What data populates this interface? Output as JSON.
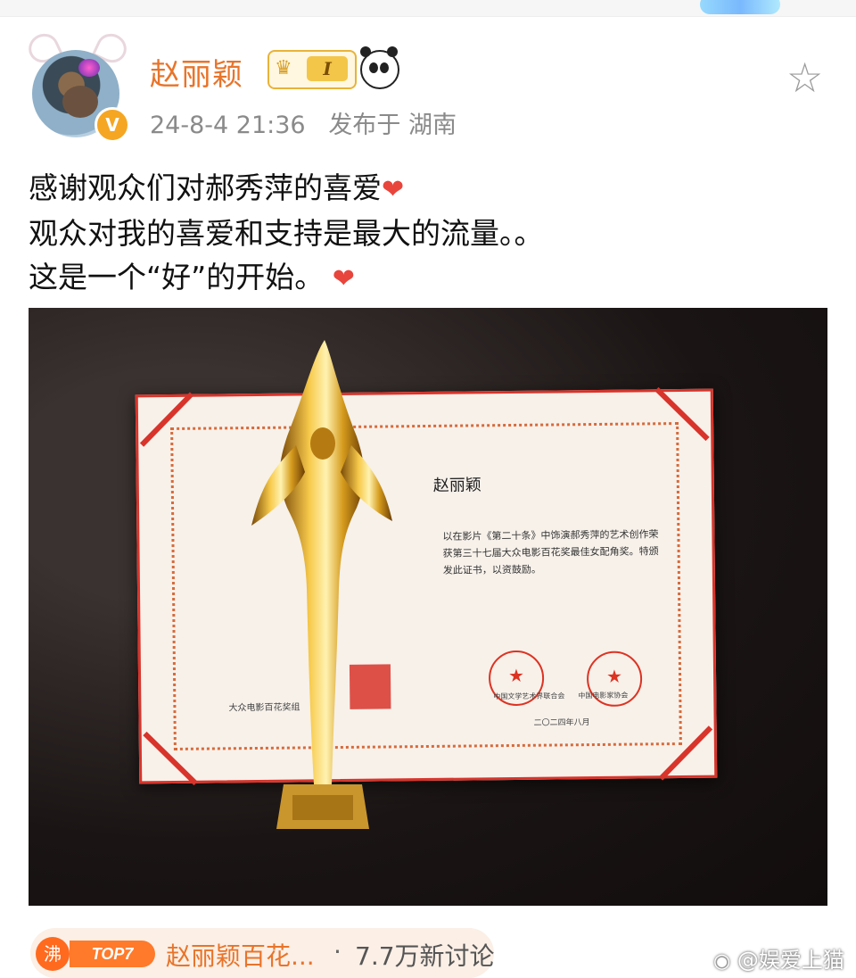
{
  "post": {
    "username": "赵丽颖",
    "level_badge": "I",
    "timestamp": "24-8-4 21:36",
    "location": "发布于 湖南",
    "text_lines": [
      "感谢观众们对郝秀萍的喜爱",
      "观众对我的喜爱和支持是最大的流量。。",
      "这是一个“好”的开始。"
    ],
    "icons": [
      "crown-badge-icon",
      "panda-icon",
      "star-icon",
      "heart-icon",
      "verified-icon"
    ],
    "accent_color": "#e8742a"
  },
  "certificate": {
    "recipient": "赵丽颖",
    "body": "以在影片《第二十条》中饰演郝秀萍的艺术创作荣获第三十七届大众电影百花奖最佳女配角奖。特颁发此证书，以资鼓励。",
    "org1": "中国文学艺术界联合会",
    "org2": "中国电影家协会",
    "date": "二〇二四年八月",
    "left_text": "大众电影百花奖组"
  },
  "topic": {
    "hot_label": "沸",
    "rank_label": "TOP7",
    "title": "赵丽颖百花...",
    "separator": "·",
    "count": "7.7万新讨论"
  },
  "watermark": "@娱爱上猫"
}
